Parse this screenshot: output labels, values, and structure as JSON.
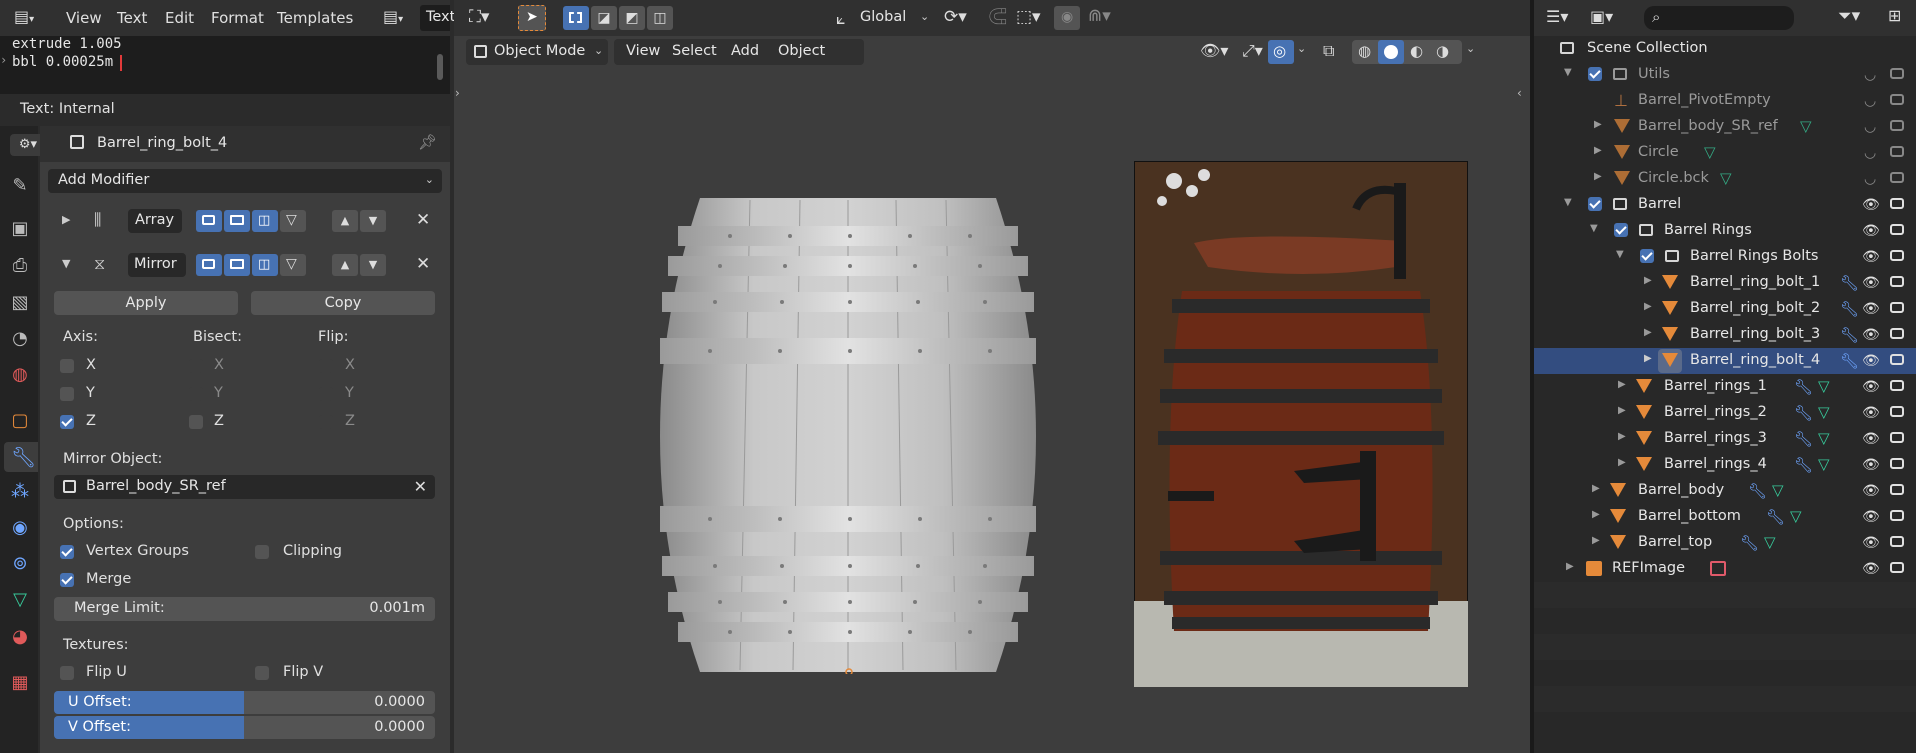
{
  "text_editor": {
    "menu": [
      "View",
      "Text",
      "Edit",
      "Format",
      "Templates"
    ],
    "tab_label": "Text",
    "lines": [
      "extrude 1.005",
      "bbl 0.00025m"
    ],
    "footer": "Text: Internal"
  },
  "properties": {
    "object_name": "Barrel_ring_bolt_4",
    "add_modifier": "Add Modifier",
    "modifiers": [
      {
        "name": "Array"
      },
      {
        "name": "Mirror"
      }
    ],
    "apply": "Apply",
    "copy": "Copy",
    "axis_header": "Axis:",
    "bisect_header": "Bisect:",
    "flip_header": "Flip:",
    "axes": [
      "X",
      "Y",
      "Z"
    ],
    "axis_checked": [
      false,
      false,
      true
    ],
    "mirror_object_label": "Mirror Object:",
    "mirror_object": "Barrel_body_SR_ref",
    "options_label": "Options:",
    "vertex_groups": "Vertex Groups",
    "clipping": "Clipping",
    "merge": "Merge",
    "merge_limit_label": "Merge Limit:",
    "merge_limit_value": "0.001m",
    "textures_label": "Textures:",
    "flip_u": "Flip U",
    "flip_v": "Flip V",
    "u_offset_label": "U Offset:",
    "u_offset_value": "0.0000",
    "v_offset_label": "V Offset:",
    "v_offset_value": "0.0000"
  },
  "viewport": {
    "transform_orientation": "Global",
    "mode": "Object Mode",
    "menu": [
      "View",
      "Select",
      "Add",
      "Object"
    ]
  },
  "outliner": {
    "scene_collection": "Scene Collection",
    "rows": [
      {
        "name": "Utils",
        "dim": true
      },
      {
        "name": "Barrel_PivotEmpty",
        "dim": true
      },
      {
        "name": "Barrel_body_SR_ref",
        "dim": true
      },
      {
        "name": "Circle",
        "dim": true
      },
      {
        "name": "Circle.bck",
        "dim": true
      },
      {
        "name": "Barrel"
      },
      {
        "name": "Barrel Rings"
      },
      {
        "name": "Barrel Rings Bolts"
      },
      {
        "name": "Barrel_ring_bolt_1"
      },
      {
        "name": "Barrel_ring_bolt_2"
      },
      {
        "name": "Barrel_ring_bolt_3"
      },
      {
        "name": "Barrel_ring_bolt_4",
        "selected": true
      },
      {
        "name": "Barrel_rings_1"
      },
      {
        "name": "Barrel_rings_2"
      },
      {
        "name": "Barrel_rings_3"
      },
      {
        "name": "Barrel_rings_4"
      },
      {
        "name": "Barrel_body"
      },
      {
        "name": "Barrel_bottom"
      },
      {
        "name": "Barrel_top"
      },
      {
        "name": "REFImage"
      }
    ]
  },
  "colors": {
    "accent_blue": "#4772b3",
    "selection": "#334d80",
    "object_orange": "#e58a3a",
    "mesh_green": "#37c99a",
    "modifier_blue": "#6fa6ff"
  }
}
